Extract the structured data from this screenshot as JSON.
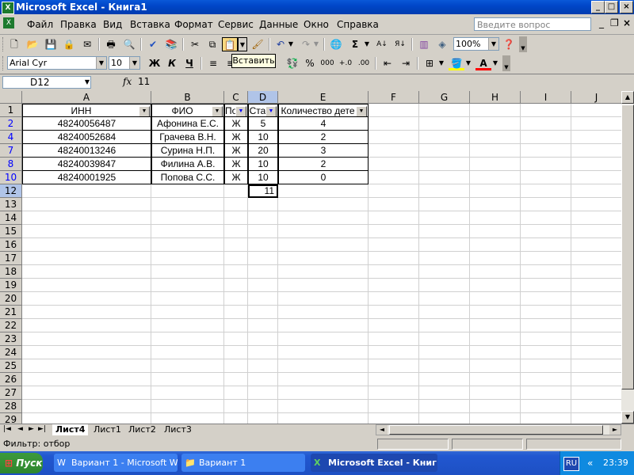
{
  "window": {
    "title": "Microsoft Excel - Книга1",
    "min": "_",
    "max": "□",
    "close": "×"
  },
  "menu": [
    "Файл",
    "Правка",
    "Вид",
    "Вставка",
    "Формат",
    "Сервис",
    "Данные",
    "Окно",
    "Справка"
  ],
  "ask_placeholder": "Введите вопрос",
  "toolbar": {
    "zoom": "100%",
    "tooltip": "Вставить"
  },
  "format": {
    "font": "Arial Cyr",
    "size": "10",
    "bold": "Ж",
    "italic": "К",
    "underline": "Ч",
    "percent": "%",
    "thousands": "000"
  },
  "namebox": "D12",
  "fx": "fx",
  "formula": "11",
  "columns": [
    "A",
    "B",
    "C",
    "D",
    "E",
    "F",
    "G",
    "H",
    "I",
    "J"
  ],
  "rows": [
    "1",
    "2",
    "4",
    "7",
    "8",
    "10",
    "12",
    "13",
    "14",
    "15",
    "16",
    "17",
    "18",
    "19",
    "20",
    "21",
    "22",
    "23",
    "24",
    "25",
    "26",
    "27",
    "28",
    "29"
  ],
  "headers": [
    "ИНН",
    "ФИО",
    "По",
    "Ста",
    "Количество дете"
  ],
  "data": [
    [
      "48240056487",
      "Афонина Е.С.",
      "Ж",
      "5",
      "4"
    ],
    [
      "48240052684",
      "Грачева В.Н.",
      "Ж",
      "10",
      "2"
    ],
    [
      "48240013246",
      "Сурина Н.П.",
      "Ж",
      "20",
      "3"
    ],
    [
      "48240039847",
      "Филина А.В.",
      "Ж",
      "10",
      "2"
    ],
    [
      "48240001925",
      "Попова С.С.",
      "Ж",
      "10",
      "0"
    ]
  ],
  "active_cell_value": "11",
  "sheets": [
    "Лист4",
    "Лист1",
    "Лист2",
    "Лист3"
  ],
  "status": "Фильтр: отбор",
  "taskbar": {
    "start": "Пуск",
    "tasks": [
      "Вариант 1 - Microsoft W...",
      "Вариант 1",
      "Microsoft Excel - Книг..."
    ],
    "lang": "RU",
    "clock": "23:39"
  }
}
